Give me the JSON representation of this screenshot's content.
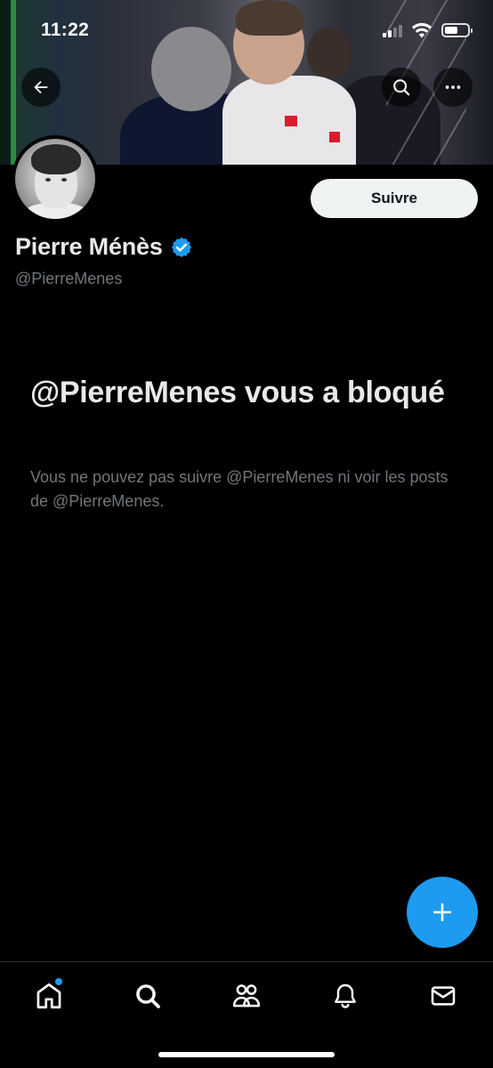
{
  "status_bar": {
    "time": "11:22",
    "signal_bars": 4,
    "signal_bars_filled": 2,
    "battery_level_percent": 60
  },
  "header": {
    "back_icon": "arrow-left-icon",
    "search_icon": "search-icon",
    "more_icon": "more-horizontal-icon"
  },
  "profile": {
    "display_name": "Pierre Ménès",
    "handle": "@PierreMenes",
    "verified": true,
    "follow_label": "Suivre"
  },
  "blocked": {
    "title": "@PierreMenes vous a bloqué",
    "description": "Vous ne pouvez pas suivre @PierreMenes ni voir les posts de @PierreMenes."
  },
  "fab": {
    "icon": "plus-icon"
  },
  "bottom_nav": {
    "items": [
      {
        "name": "home",
        "icon": "home-icon",
        "active": true,
        "has_notification_dot": true
      },
      {
        "name": "search",
        "icon": "search-icon",
        "active": false
      },
      {
        "name": "communities",
        "icon": "communities-icon",
        "active": false
      },
      {
        "name": "notifications",
        "icon": "bell-icon",
        "active": false
      },
      {
        "name": "messages",
        "icon": "mail-icon",
        "active": false
      }
    ]
  },
  "colors": {
    "background": "#000000",
    "accent": "#1d9bf0",
    "primary_text": "#e7e9ea",
    "secondary_text": "#71767b",
    "follow_button_bg": "#eff3f4"
  }
}
